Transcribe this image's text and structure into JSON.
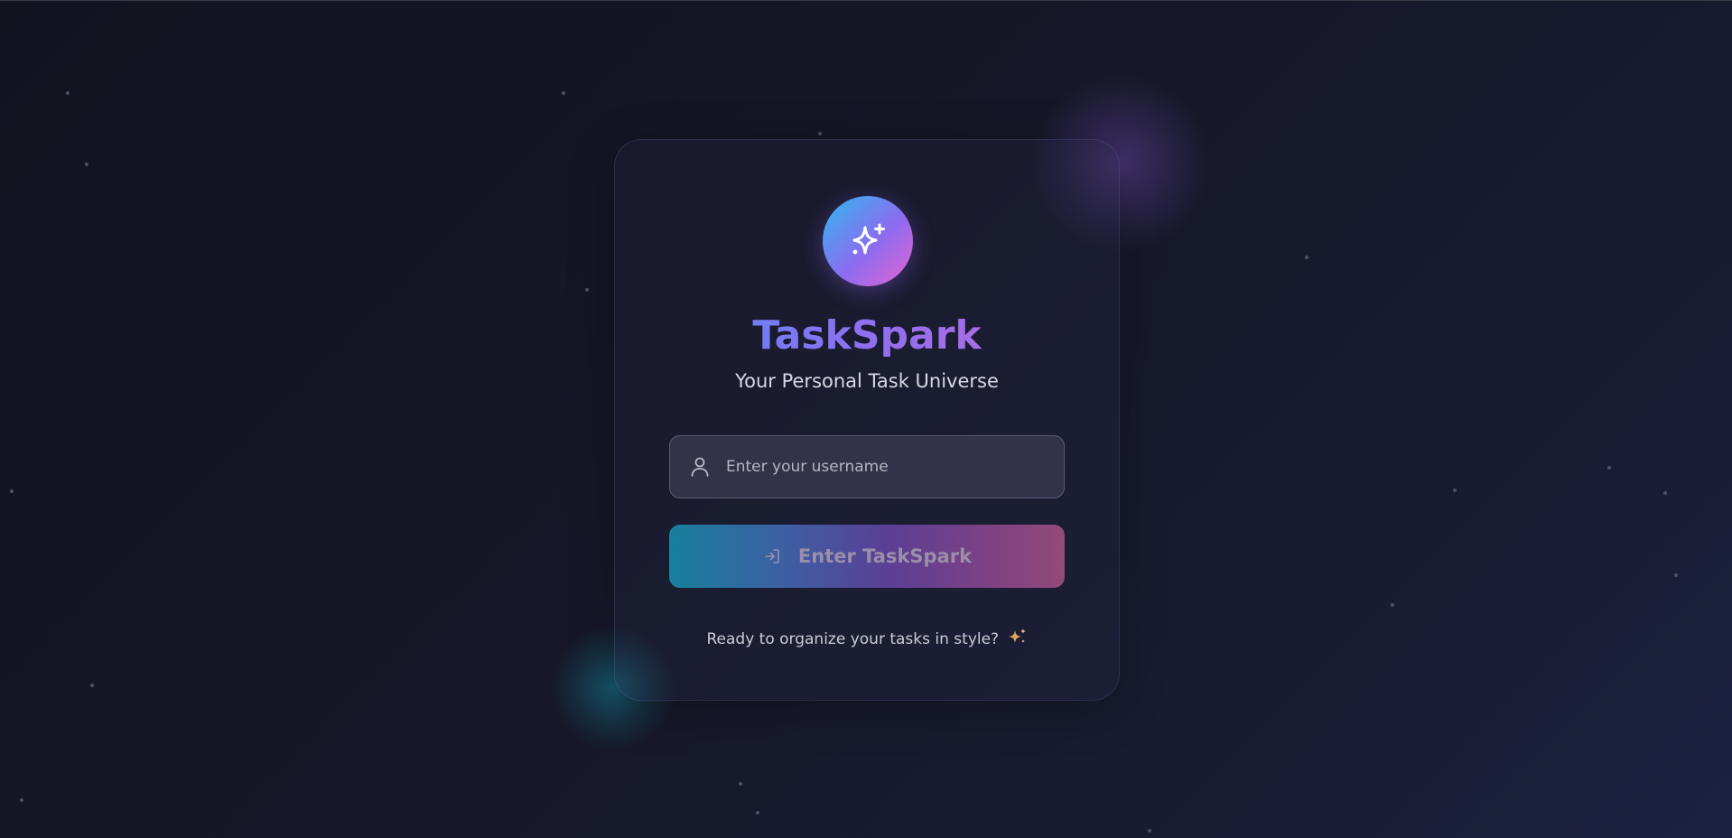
{
  "app": {
    "name": "TaskSpark",
    "tagline": "Your Personal Task Universe"
  },
  "login": {
    "username_placeholder": "Enter your username",
    "username_value": "",
    "submit_label": "Enter TaskSpark",
    "footer_text": "Ready to organize your tasks in style?"
  },
  "icons": {
    "logo": "sparkles-icon",
    "username_field": "user-icon",
    "submit": "log-in-icon",
    "footer": "sparkles-emoji-icon"
  },
  "colors": {
    "background_dark": "#12131f",
    "background_light": "#1a2240",
    "logo_gradient_start": "#2fb8f0",
    "logo_gradient_end": "#e765d0",
    "title_gradient_start": "#4f8ff7",
    "title_gradient_end": "#c46ad8",
    "button_gradient_start": "#17809c",
    "button_gradient_mid": "#5a3f95",
    "button_gradient_end": "#934a79",
    "subtitle_text": "#d6d8e6",
    "placeholder_text": "#b3b5c4"
  }
}
